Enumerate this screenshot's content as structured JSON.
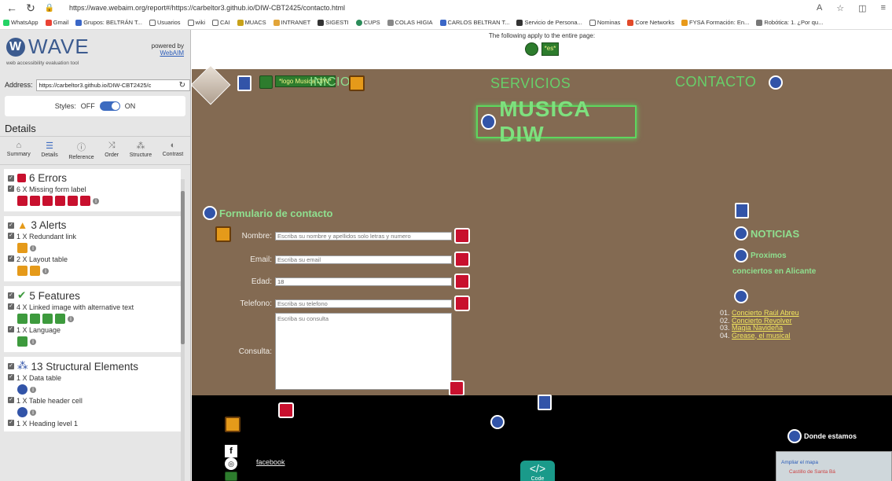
{
  "browser": {
    "url": "https://wave.webaim.org/report#/https://carbeltor3.github.io/DIW-CBT2425/contacto.html",
    "bookmarks": [
      "WhatsApp",
      "Gmail",
      "Grupos: BELTRÁN T...",
      "Usuarios",
      "wiki",
      "CAI",
      "MUACS",
      "INTRANET",
      "SIGESTI",
      "CUPS",
      "COLAS HIGIA",
      "CARLOS BELTRAN T...",
      "Servicio de Persona...",
      "Nominas",
      "Core Networks",
      "FYSA Formación: En...",
      "Robótica: 1. ¿Por qu..."
    ]
  },
  "wave": {
    "logo": "WAVE",
    "tagline": "web accessibility evaluation tool",
    "powered_by": "powered by",
    "webaim": "WebAIM",
    "address_label": "Address:",
    "address_value": "https://carbeltor3.github.io/DIW-CBT2425/c",
    "styles_label": "Styles:",
    "styles_off": "OFF",
    "styles_on": "ON",
    "details_title": "Details",
    "tabs": [
      "Summary",
      "Details",
      "Reference",
      "Order",
      "Structure",
      "Contrast"
    ],
    "categories": {
      "errors": {
        "title": "6 Errors",
        "items": [
          {
            "text": "6 X Missing form label"
          }
        ]
      },
      "alerts": {
        "title": "3 Alerts",
        "items": [
          {
            "text": "1 X Redundant link"
          },
          {
            "text": "2 X Layout table"
          }
        ]
      },
      "features": {
        "title": "5 Features",
        "items": [
          {
            "text": "4 X Linked image with alternative text"
          },
          {
            "text": "1 X Language"
          }
        ]
      },
      "structure": {
        "title": "13 Structural Elements",
        "items": [
          {
            "text": "1 X Data table"
          },
          {
            "text": "1 X Table header cell"
          },
          {
            "text": "1 X Heading level 1"
          }
        ]
      }
    }
  },
  "page": {
    "note": "The following apply to the entire page:",
    "lang_badge": "*es*",
    "img_label": "*logo Musica DIW*",
    "nav": {
      "inicio": "INICIO",
      "servicios": "SERVICIOS",
      "contacto": "CONTACTO"
    },
    "hero": "MUSICA DIW",
    "form_title": "Formulario de contacto",
    "fields": {
      "nombre": {
        "label": "Nombre:",
        "placeholder": "Escriba su nombre y apellidos solo letras y numero"
      },
      "email": {
        "label": "Email:",
        "placeholder": "Escriba su email"
      },
      "edad": {
        "label": "Edad:",
        "value": "18"
      },
      "telefono": {
        "label": "Telefono:",
        "placeholder": "Escriba su telefono"
      },
      "consulta": {
        "label": "Consulta:",
        "placeholder": "Escriba su consulta"
      }
    },
    "noticias": "NOTICIAS",
    "proximos": "Proximos",
    "proximos_rest": "conciertos en Alicante",
    "concerts": [
      {
        "num": "01.",
        "title": "Concierto Raúl Abreu"
      },
      {
        "num": "02.",
        "title": "Concierto Revolver"
      },
      {
        "num": "03.",
        "title": "Magia Navideña"
      },
      {
        "num": "04.",
        "title": "Grease, el musical"
      }
    ],
    "donde": "Donde estamos",
    "map_ampliar": "Ampliar el mapa",
    "map_place": "Castillo de Santa Bá",
    "facebook": "facebook",
    "code_label": "Code",
    "code_glyph": "</>"
  },
  "colors": {
    "page_bg": "#836a52",
    "accent_green": "#67d06a",
    "wave_blue": "#3c5b8f",
    "error": "#c8102e",
    "alert": "#e59a1a",
    "feature": "#2d7c2d",
    "structure": "#3254a8"
  }
}
